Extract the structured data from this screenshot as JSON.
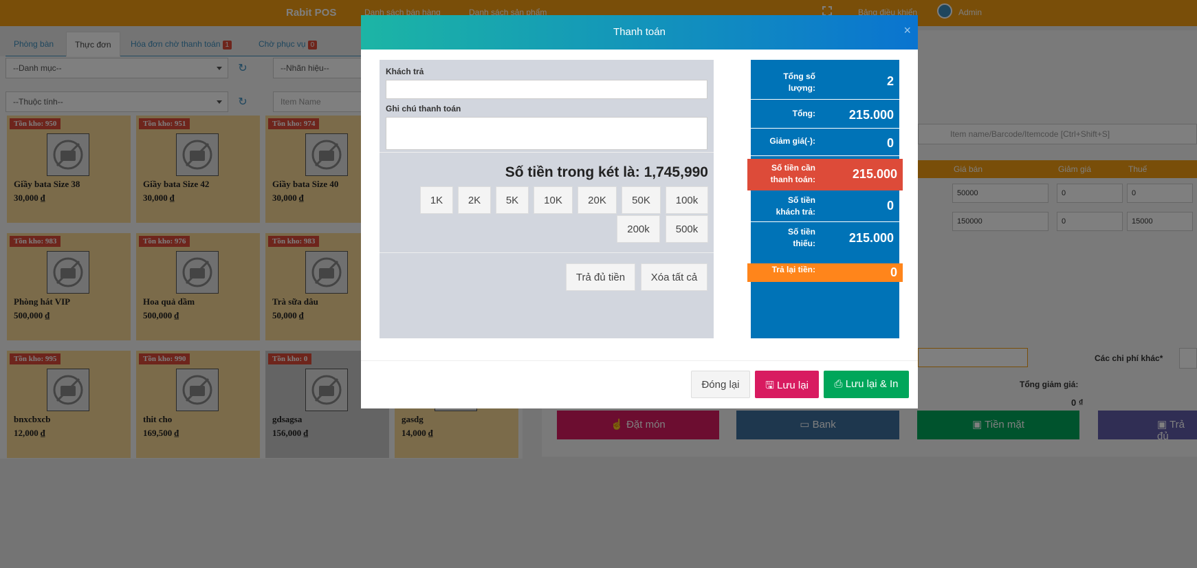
{
  "topbar": {
    "brand": "Rabit POS",
    "nav": [
      "Danh sách bán hàng",
      "Danh sách sản phẩm"
    ],
    "dashboard": "Bảng điều khiển",
    "user": "Admin"
  },
  "tabs": [
    {
      "label": "Phòng bàn"
    },
    {
      "label": "Thực đơn"
    },
    {
      "label": "Hóa đơn chờ thanh toán",
      "badge": "1"
    },
    {
      "label": "Chờ phục vụ",
      "badge": "0"
    }
  ],
  "filters": {
    "category": "--Danh mục--",
    "brand": "--Nhãn hiệu--",
    "attribute": "--Thuộc tính--",
    "item_name_placeholder": "Item Name"
  },
  "products": [
    {
      "stock": "Tồn kho: 950",
      "name": "Giầy bata Size 38",
      "price": "30,000 ₫"
    },
    {
      "stock": "Tồn kho: 951",
      "name": "Giầy bata Size 42",
      "price": "30,000 ₫"
    },
    {
      "stock": "Tồn kho: 974",
      "name": "Giầy bata Size 40",
      "price": "30,000 ₫"
    },
    {
      "stock": "Tồn kho: 983",
      "name": "Phòng hát VIP",
      "price": "500,000 ₫"
    },
    {
      "stock": "Tồn kho: 976",
      "name": "Hoa quả dầm",
      "price": "500,000 ₫"
    },
    {
      "stock": "Tồn kho: 983",
      "name": "Trà sữa dâu",
      "price": "50,000 ₫"
    },
    {
      "stock": "Tồn kho: 995",
      "name": "bnxcbxcb",
      "price": "12,000 ₫"
    },
    {
      "stock": "Tồn kho: 990",
      "name": "thit cho",
      "price": "169,500 ₫"
    },
    {
      "stock": "Tồn kho: 0",
      "name": "gdsagsa",
      "price": "156,000 ₫"
    },
    {
      "stock": "",
      "name": "gasdg",
      "price": "14,000 ₫"
    }
  ],
  "cart": {
    "search_placeholder": "Item name/Barcode/Itemcode [Ctrl+Shift+S]",
    "columns": [
      "Giá bán",
      "Giảm giá",
      "Thuế"
    ],
    "rows": [
      [
        "50000",
        "0",
        "0"
      ],
      [
        "150000",
        "0",
        "15000"
      ]
    ],
    "other_fees_label": "Các chi phí khác*",
    "total_discount_label": "Tổng giảm giá:",
    "total_discount_value": "0 ₫"
  },
  "actions": {
    "order": "Đặt món",
    "bank": "Bank",
    "cash": "Tiền mặt",
    "pay": "Trả đủ"
  },
  "modal": {
    "title": "Thanh toán",
    "close": "×",
    "customer_pay_label": "Khách trả",
    "customer_pay_value": "",
    "note_label": "Ghi chú thanh toán",
    "note_value": "",
    "cash_in_drawer_label": "Số tiền trong két là:",
    "cash_in_drawer_value": "1,745,990",
    "quick_amounts": [
      "1K",
      "2K",
      "5K",
      "10K",
      "20K",
      "50K",
      "100k",
      "200k",
      "500k"
    ],
    "pay_full": "Trả đủ tiền",
    "clear_all": "Xóa tất cả",
    "summary": {
      "total_qty_label": "Tổng số lượng:",
      "total_qty": "2",
      "total_label": "Tổng:",
      "total": "215.000",
      "discount_label": "Giảm giá(-):",
      "discount": "0",
      "amount_due_label": "Số tiền cần thanh toán:",
      "amount_due": "215.000",
      "customer_paid_label": "Số tiền khách trả:",
      "customer_paid": "0",
      "missing_label": "Số tiền thiếu:",
      "missing": "215.000",
      "change_label": "Trả lại tiền:",
      "change": "0"
    },
    "close_button": "Đóng lại",
    "save_button": "Lưu lại",
    "save_print_button": "Lưu lại & In"
  },
  "colors": {
    "topbar": "#f39c12",
    "summary_blue": "#0073b7",
    "amount_due_red": "#dd4b39",
    "change_orange": "#ff851b",
    "save_pink": "#d81b60",
    "save_print_green": "#00a65a"
  }
}
